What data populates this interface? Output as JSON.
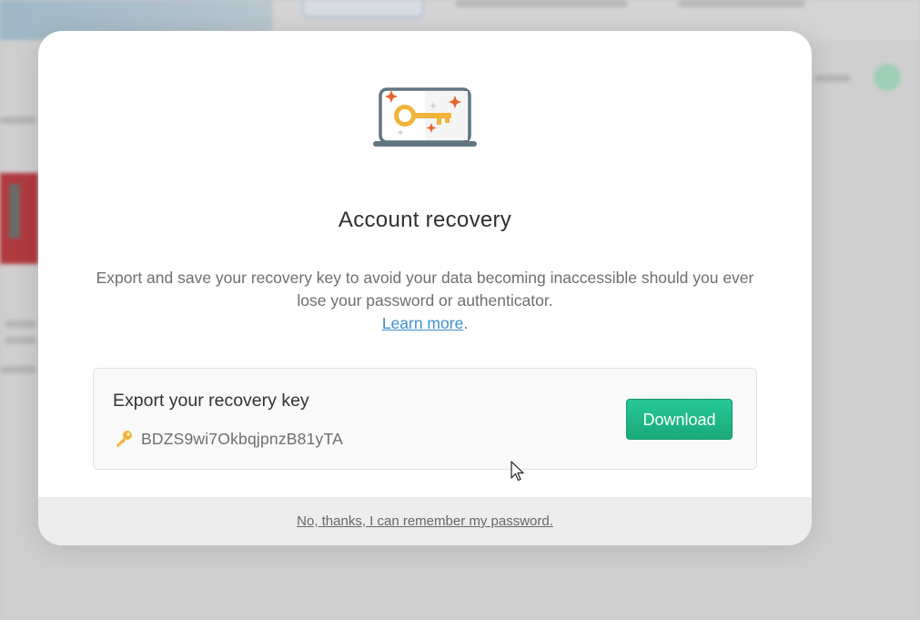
{
  "modal": {
    "title": "Account recovery",
    "description": "Export and save your recovery key to avoid your data becoming inaccessible should you ever lose your password or authenticator.",
    "learn_more": "Learn more",
    "learn_more_suffix": ".",
    "illustration": "laptop-key-illustration"
  },
  "export_card": {
    "title": "Export your recovery key",
    "key_icon": "key-icon",
    "recovery_key": "BDZS9wi7OkbqjpnzB81yTA",
    "download_label": "Download"
  },
  "footer": {
    "dismiss_label": "No, thanks, I can remember my password."
  },
  "colors": {
    "accent_green": "#1fb886",
    "link_blue": "#3f8fcc",
    "key_gold": "#f2b33a",
    "sparkle_orange": "#e8622c"
  }
}
